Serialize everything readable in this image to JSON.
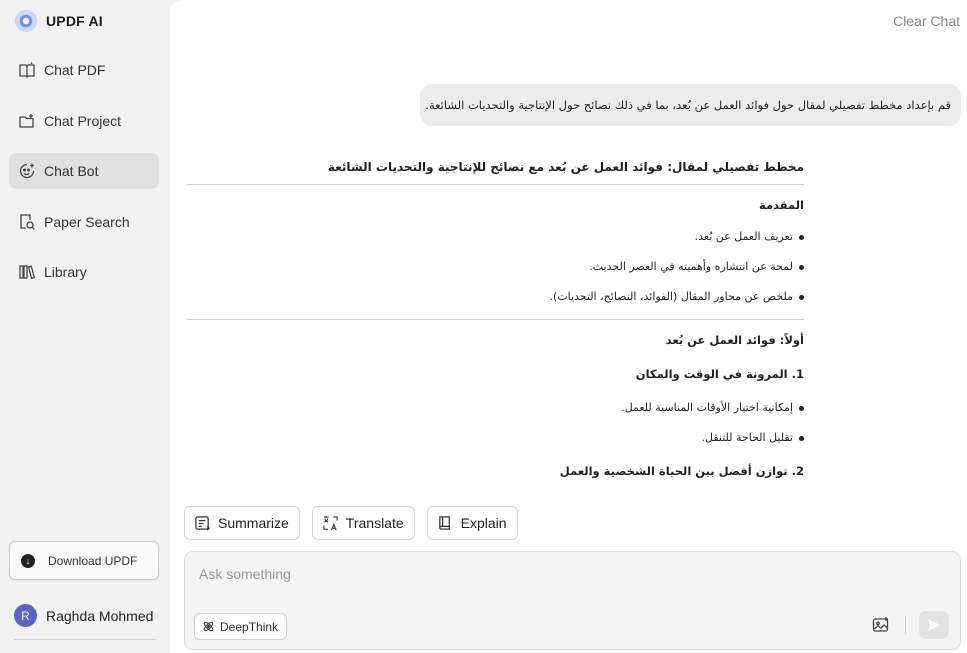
{
  "brand": {
    "name": "UPDF AI"
  },
  "sidebar": {
    "items": [
      {
        "label": "Chat PDF",
        "icon": "book-chat-icon"
      },
      {
        "label": "Chat Project",
        "icon": "folder-chat-icon"
      },
      {
        "label": "Chat Bot",
        "icon": "bot-icon",
        "active": true
      },
      {
        "label": "Paper Search",
        "icon": "doc-search-icon"
      },
      {
        "label": "Library",
        "icon": "library-icon"
      }
    ],
    "download_label": "Download UPDF",
    "user": {
      "initial": "R",
      "name": "Raghda Mohmed"
    }
  },
  "header": {
    "clear_chat": "Clear Chat"
  },
  "conversation": {
    "user_message": "قم بإعداد مخطط تفصيلي لمقال حول فوائد العمل عن بُعد، بما في ذلك نصائح حول الإنتاجية والتحديات الشائعة.",
    "answer": {
      "title": "مخطط تفصيلي لمقال: فوائد العمل عن بُعد مع نصائح للإنتاجية والتحديات الشائعة",
      "intro_heading": "المقدمة",
      "intro_items": [
        "تعريف العمل عن بُعد.",
        "لمحة عن انتشاره وأهميته في العصر الحديث.",
        "ملخص عن محاور المقال (الفوائد، النصائح، التحديات)."
      ],
      "section1_heading": "أولاً: فوائد العمل عن بُعد",
      "sub1_heading": "1. المرونة في الوقت والمكان",
      "sub1_items": [
        "إمكانية اختيار الأوقات المناسبة للعمل.",
        "تقليل الحاجة للتنقل."
      ],
      "sub2_heading": "2. توازن أفضل بين الحياة الشخصية والعمل"
    }
  },
  "actions": {
    "summarize": "Summarize",
    "translate": "Translate",
    "explain": "Explain"
  },
  "input": {
    "placeholder": "Ask something",
    "deepthink_label": "DeepThink"
  },
  "colors": {
    "sidebar_bg": "#f2f2f2",
    "active_item_bg": "#e0e0e0",
    "bubble_bg": "#ececec",
    "avatar_bg": "#5a63c7"
  }
}
